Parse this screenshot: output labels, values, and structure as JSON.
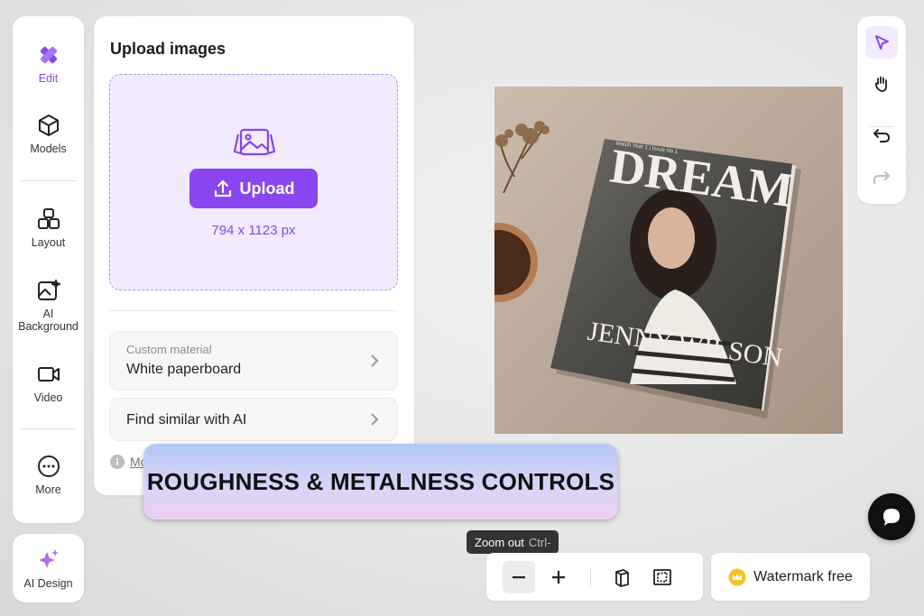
{
  "rail": {
    "items": [
      {
        "label": "Edit",
        "icon": "pencil-ruler-icon"
      },
      {
        "label": "Models",
        "icon": "cube-icon"
      },
      {
        "label": "Layout",
        "icon": "stacked-boxes-icon"
      },
      {
        "label": "AI Background",
        "label_line1": "AI",
        "label_line2": "Background",
        "icon": "ai-image-icon"
      },
      {
        "label": "Video",
        "icon": "video-camera-icon"
      },
      {
        "label": "More",
        "icon": "more-dots-icon"
      }
    ],
    "ai_design": {
      "label": "AI Design",
      "icon": "sparkle-icon"
    }
  },
  "upload": {
    "title": "Upload images",
    "button_label": "Upload",
    "size_hint": "794 x 1123 px",
    "material": {
      "label": "Custom material",
      "value": "White paperboard"
    },
    "similar": {
      "label": "Find similar with AI"
    },
    "info_text": "Mo"
  },
  "banner": {
    "text": "ROUGHNESS & METALNESS CONTROLS"
  },
  "canvas": {
    "magazine": {
      "masthead": "DREAM",
      "cover_name": "JENNY WILSON",
      "issue": "March Year 1 | Issue No.1"
    }
  },
  "zoom": {
    "tooltip_label": "Zoom out",
    "tooltip_shortcut": "Ctrl-"
  },
  "watermark": {
    "label": "Watermark free"
  },
  "colors": {
    "accent": "#8a45f0",
    "accent_light": "#f1ebfd",
    "dark": "#111111"
  }
}
